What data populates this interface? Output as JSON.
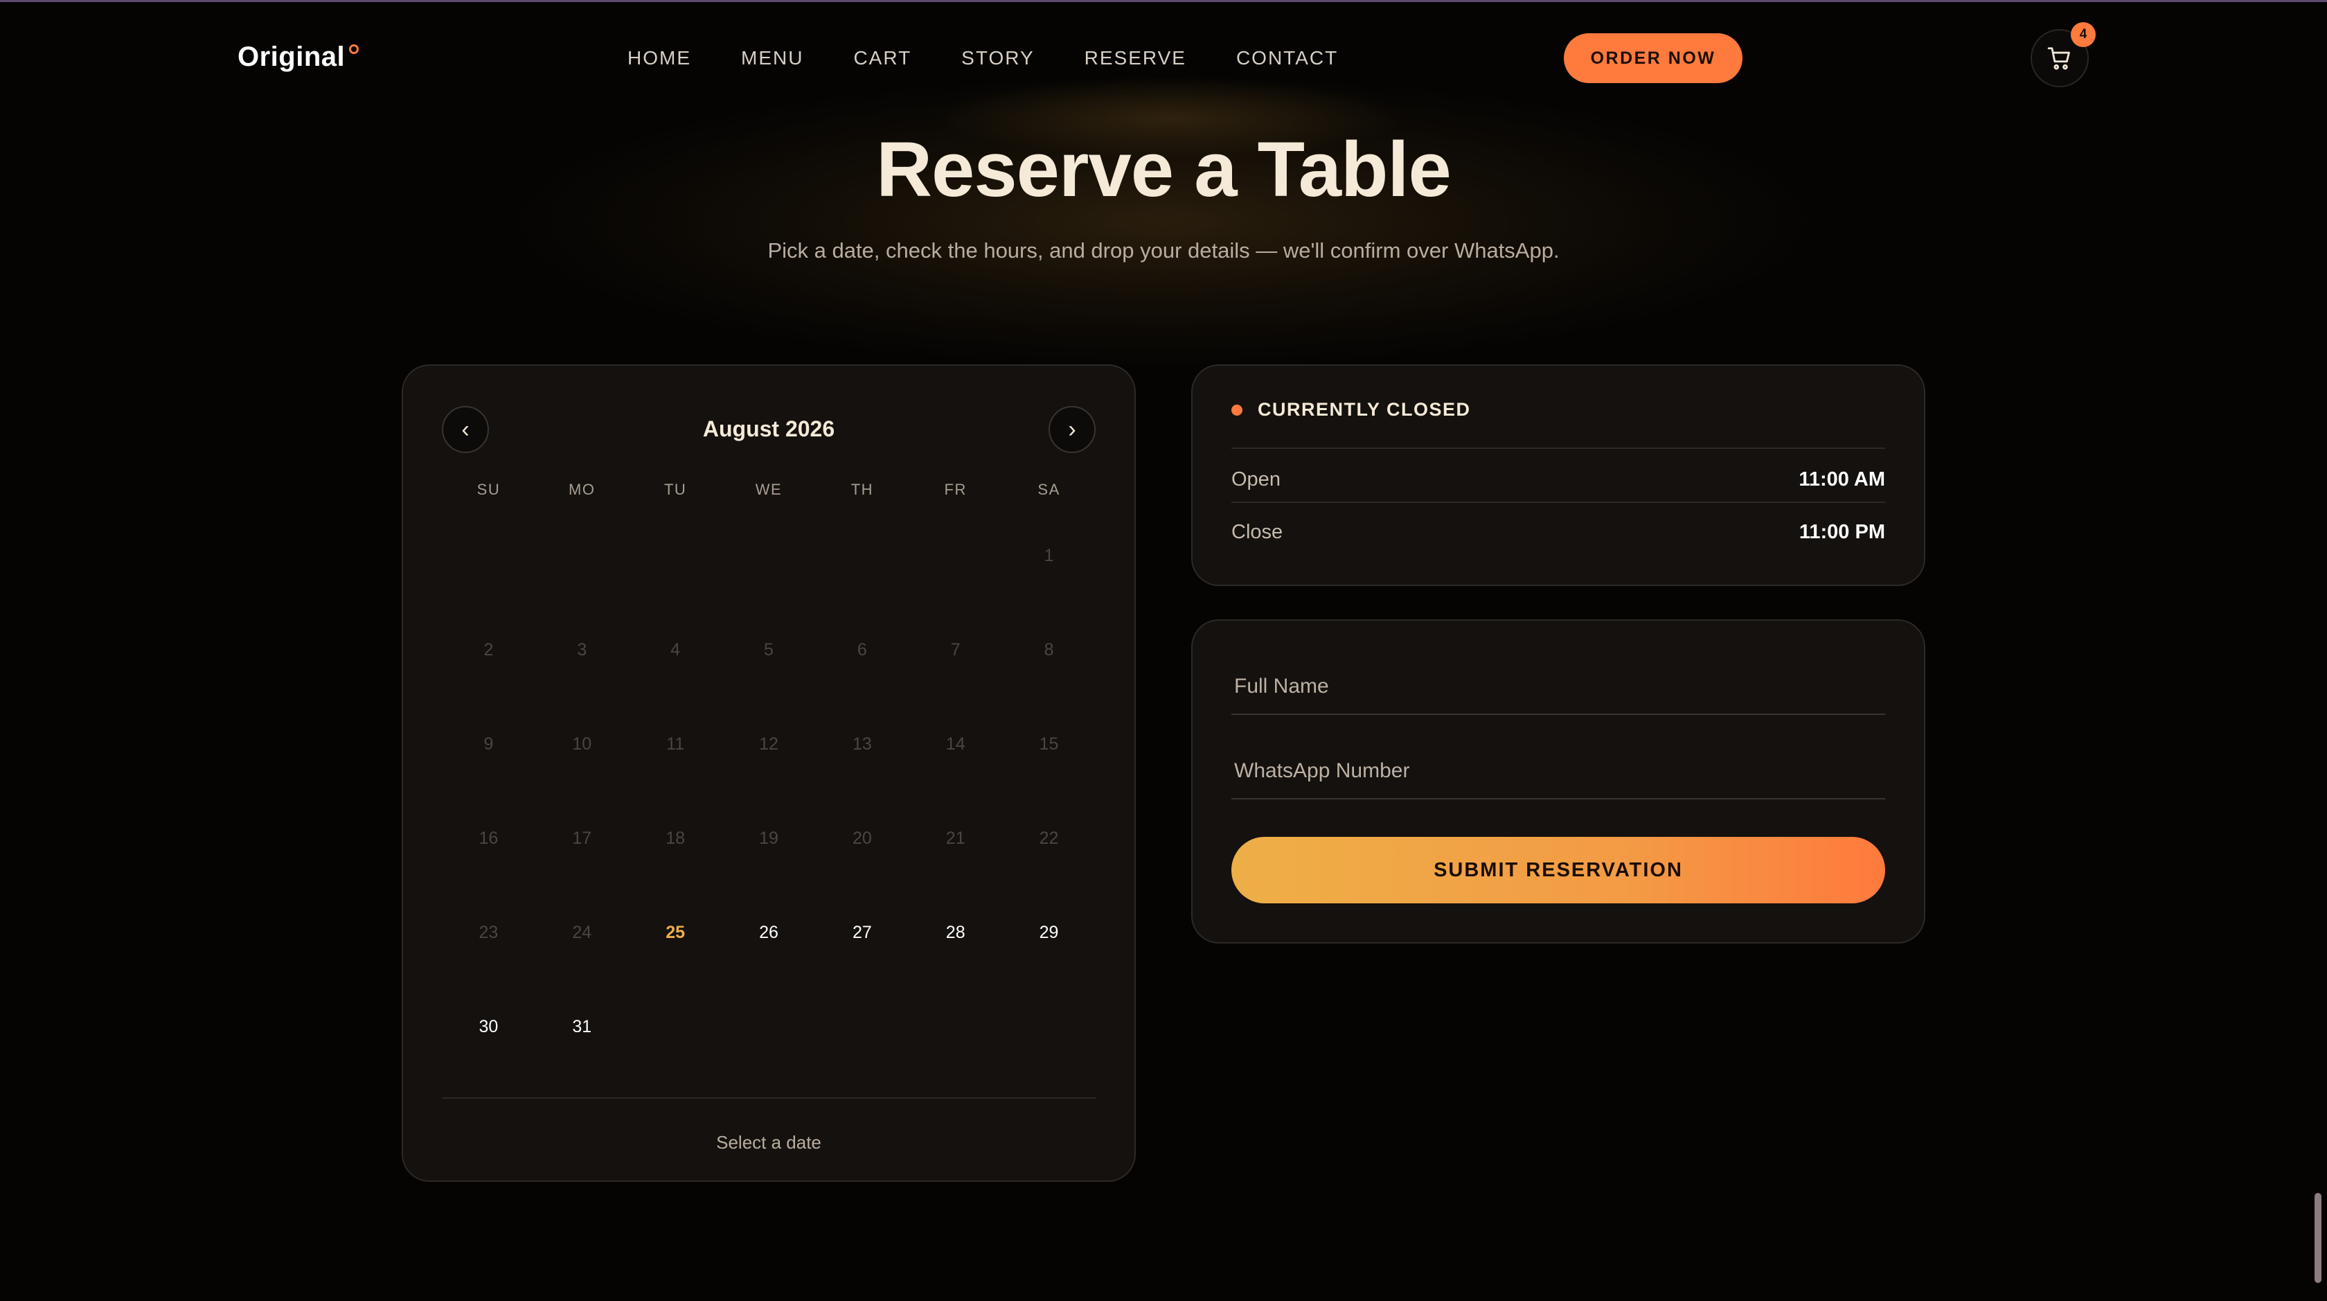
{
  "brand": {
    "name": "Original"
  },
  "nav": {
    "links": [
      "HOME",
      "MENU",
      "CART",
      "STORY",
      "RESERVE",
      "CONTACT"
    ],
    "order_label": "ORDER NOW",
    "cart_count": "4"
  },
  "hero": {
    "title": "Reserve a Table",
    "subtitle": "Pick a date, check the hours, and drop your details — we'll confirm over WhatsApp."
  },
  "calendar": {
    "prev_label": "‹",
    "next_label": "›",
    "month": "August 2026",
    "weekdays": [
      "SU",
      "MO",
      "TU",
      "WE",
      "TH",
      "FR",
      "SA"
    ],
    "leading_blanks": 6,
    "days": [
      "1",
      "2",
      "3",
      "4",
      "5",
      "6",
      "7",
      "8",
      "9",
      "10",
      "11",
      "12",
      "13",
      "14",
      "15",
      "16",
      "17",
      "18",
      "19",
      "20",
      "21",
      "22",
      "23",
      "24",
      "25",
      "26",
      "27",
      "28",
      "29",
      "30",
      "31"
    ],
    "today": "25",
    "hint": "Select a date"
  },
  "hours": {
    "status": "CURRENTLY CLOSED",
    "open_label": "Open",
    "open_time": "11:00 AM",
    "close_label": "Close",
    "close_time": "11:00 PM"
  },
  "form": {
    "name_placeholder": "Full Name",
    "whatsapp_placeholder": "WhatsApp Number",
    "submit_label": "SUBMIT RESERVATION"
  },
  "colors": {
    "accent": "#ff7a3d",
    "today": "#f0ae48",
    "background": "#050403",
    "card": "#14110e"
  }
}
